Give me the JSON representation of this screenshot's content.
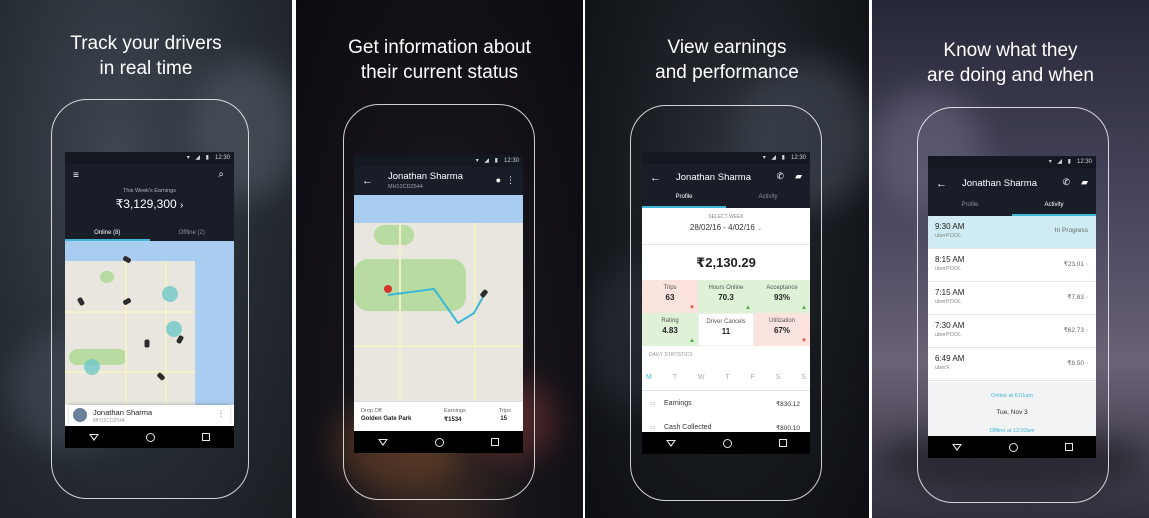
{
  "panels": [
    {
      "headline": [
        "Track your drivers",
        "in real time"
      ]
    },
    {
      "headline": [
        "Get information about",
        "their current status"
      ]
    },
    {
      "headline": [
        "View earnings",
        "and performance"
      ]
    },
    {
      "headline": [
        "Know what they",
        "are doing and when"
      ]
    }
  ],
  "status_time": "12:30",
  "screen1": {
    "earnings_label": "This Week's Earnings",
    "earnings_value": "₹3,129,300",
    "tab_online": "Online (8)",
    "tab_offline": "Offline (2)",
    "driver_name": "Jonathan Sharma",
    "driver_plate": "MH12CD2544"
  },
  "screen2": {
    "name": "Jonathan Sharma",
    "plate": "MH12CD2544",
    "dropoff_label": "Drop Off",
    "dropoff_value": "Golden Gate Park",
    "earnings_label": "Earnings",
    "earnings_value": "₹1534",
    "trips_label": "Trips",
    "trips_value": "15"
  },
  "screen3": {
    "name": "Jonathan Sharma",
    "tab_profile": "Profile",
    "tab_activity": "Activity",
    "select_week": "SELECT WEEK",
    "week_range": "28/02/16 - 4/02/16",
    "total": "₹2,130.29",
    "stats": [
      {
        "label": "Trips",
        "value": "63"
      },
      {
        "label": "Hours Online",
        "value": "70.3"
      },
      {
        "label": "Acceptance",
        "value": "93%"
      },
      {
        "label": "Rating",
        "value": "4.83"
      },
      {
        "label": "Driver Cancels",
        "value": "11"
      },
      {
        "label": "Utilization",
        "value": "67%"
      }
    ],
    "daily_stats": "DAILY STATISTICS",
    "days": [
      "M",
      "T",
      "W",
      "T",
      "F",
      "S",
      "S"
    ],
    "earnings_label": "Earnings",
    "earnings_value": "₹830.12",
    "cash_label": "Cash Collected",
    "cash_value": "₹800.10"
  },
  "screen4": {
    "name": "Jonathan Sharma",
    "tab_profile": "Profile",
    "tab_activity": "Activity",
    "trips": [
      {
        "time": "9:30 AM",
        "kind": "uberPOOL",
        "amount": "In Progress"
      },
      {
        "time": "8:15 AM",
        "kind": "uberPOOL",
        "amount": "₹23.01"
      },
      {
        "time": "7:15 AM",
        "kind": "uberPOOL",
        "amount": "₹7.83"
      },
      {
        "time": "7:30 AM",
        "kind": "uberPOOL",
        "amount": "₹62.73"
      },
      {
        "time": "6:49 AM",
        "kind": "uberX",
        "amount": "₹8.50"
      }
    ],
    "online_note": "Online at 6:01am",
    "date": "Tue, Nov 3",
    "offline_note": "Offline at 12:03am"
  },
  "colors": {
    "accent_teal": "#3fb8d6",
    "appbar": "#181d27",
    "positive": "#3bab3b",
    "negative": "#e2472a"
  }
}
